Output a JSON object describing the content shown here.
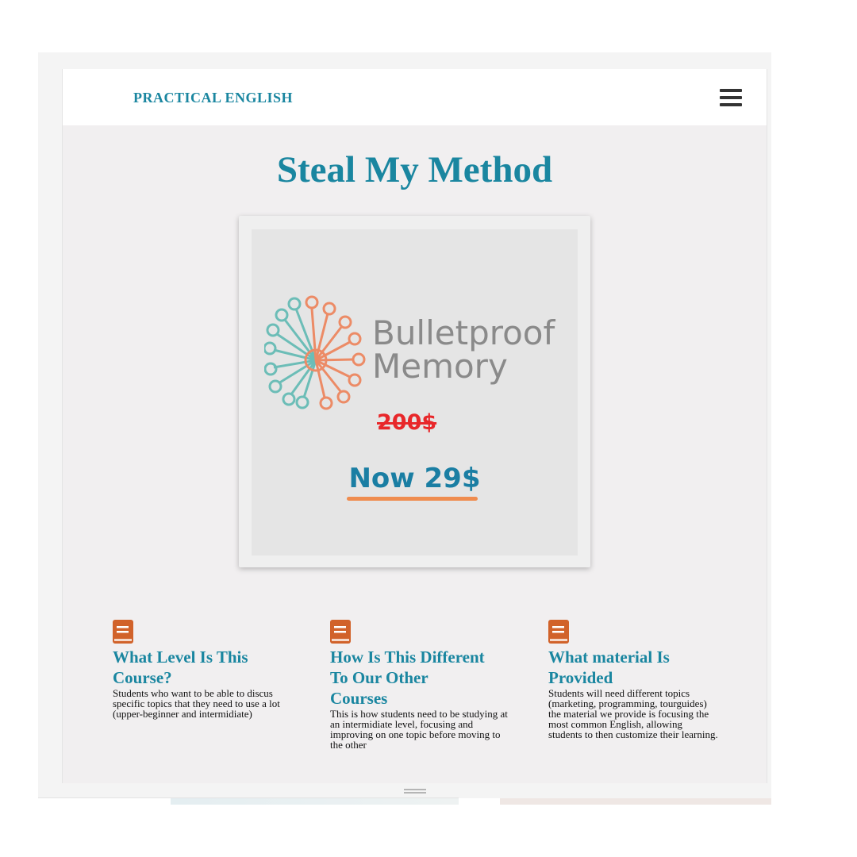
{
  "navbar": {
    "brand": "PRACTICAL ENGLISH",
    "menu_icon": "hamburger-menu-icon"
  },
  "hero": {
    "title": "Steal My Method"
  },
  "product_card": {
    "logo_line1": "Bulletproof",
    "logo_line2": "Memory",
    "old_price": "200$",
    "new_price": "Now 29$"
  },
  "features": [
    {
      "icon": "book-icon",
      "title": "What Level Is This Course?",
      "text": "Students who want to be able to discus specific topics that they need to use a lot (upper-beginner and intermidiate)"
    },
    {
      "icon": "book-icon",
      "title": "How Is This Different To Our Other Courses",
      "text": "This is how students need to be studying at an intermidiate level, focusing and improving on one topic before moving to the other"
    },
    {
      "icon": "book-icon",
      "title": "What material Is Provided",
      "text": "Students will need different topics (marketing, programming, tourguides) the material we provide is focusing the most common English, allowing students to then customize their learning."
    }
  ],
  "colors": {
    "brand": "#1a86a0",
    "old_price": "#e8272a",
    "new_price": "#1a7ea3",
    "accent_underline": "#ef8c4f",
    "book_icon": "#d1622a"
  }
}
